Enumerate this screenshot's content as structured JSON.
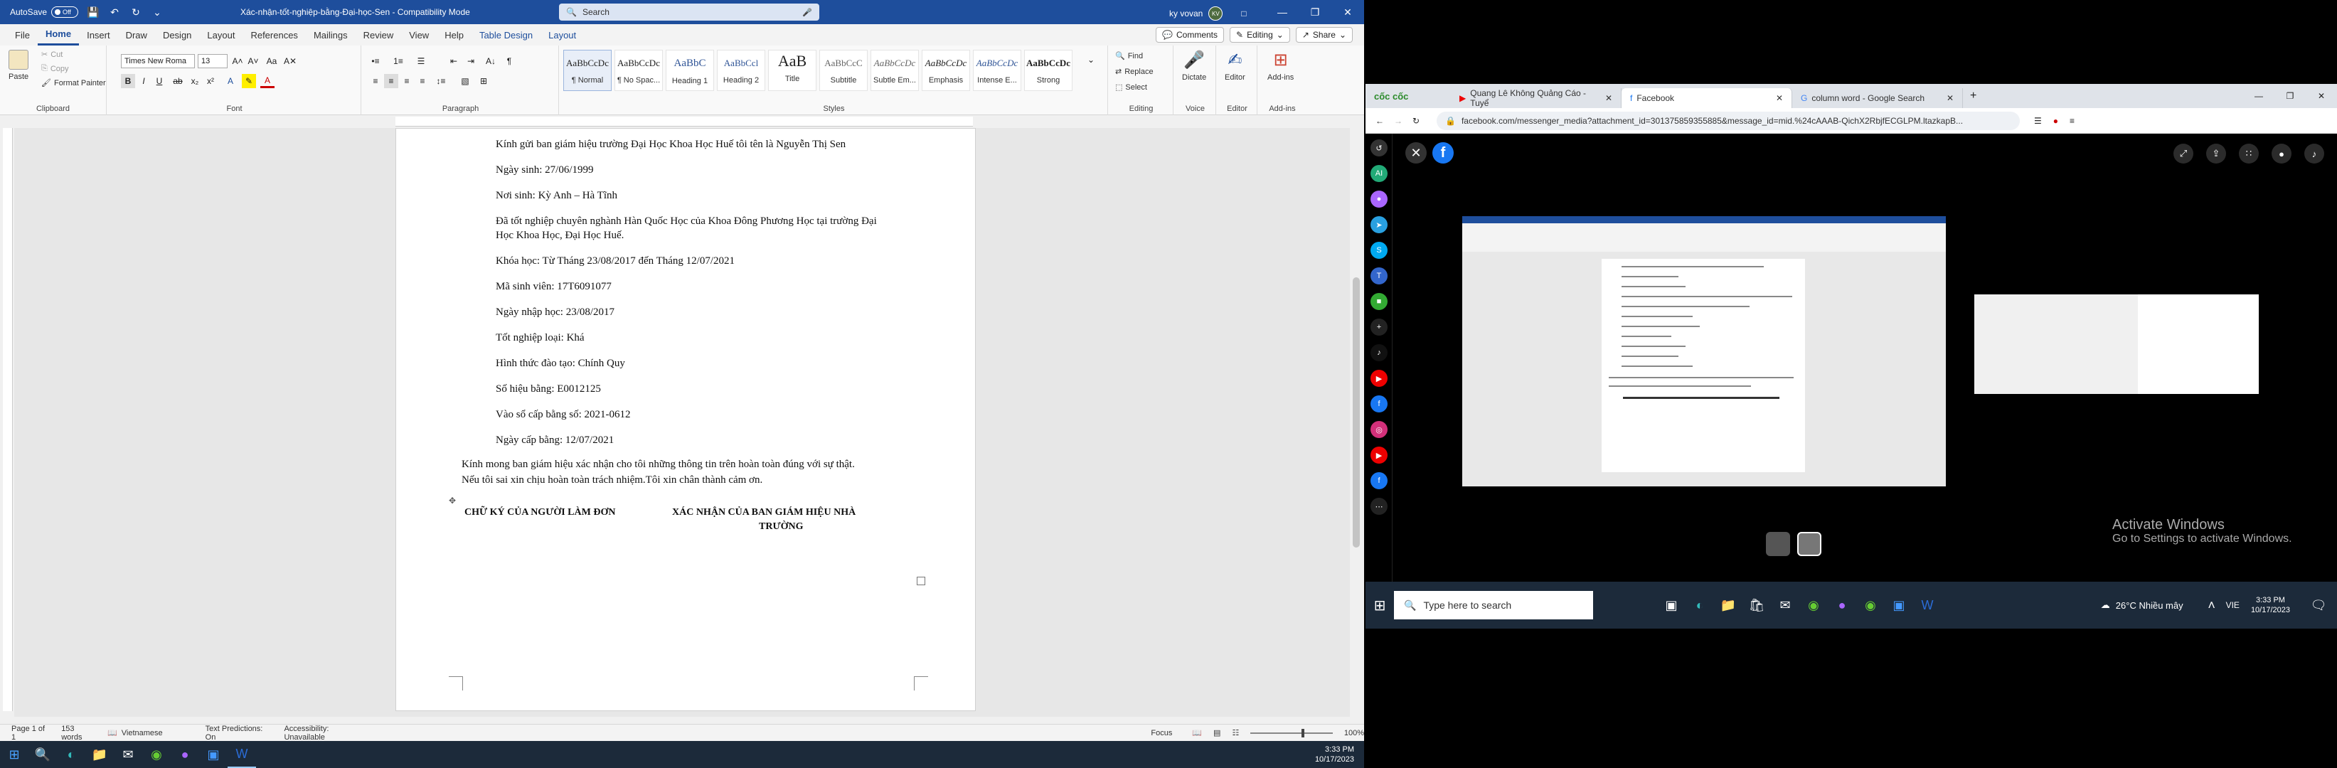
{
  "word": {
    "autosave_label": "AutoSave",
    "autosave_state": "Off",
    "doc_title": "Xác-nhận-tốt-nghiệp-bằng-Đại-học-Sen  -  Compatibility Mode",
    "search_placeholder": "Search",
    "user_name": "ky vovan",
    "user_initials": "KV",
    "tabs": [
      "File",
      "Home",
      "Insert",
      "Draw",
      "Design",
      "Layout",
      "References",
      "Mailings",
      "Review",
      "View",
      "Help",
      "Table Design",
      "Layout"
    ],
    "comments_label": "Comments",
    "editing_label": "Editing",
    "share_label": "Share",
    "ribbon": {
      "clipboard": {
        "paste": "Paste",
        "cut": "Cut",
        "copy": "Copy",
        "format_painter": "Format Painter",
        "label": "Clipboard"
      },
      "font": {
        "name": "Times New Roma",
        "size": "13",
        "label": "Font"
      },
      "paragraph_label": "Paragraph",
      "styles": [
        {
          "preview": "AaBbCcDc",
          "name": "¶ Normal"
        },
        {
          "preview": "AaBbCcDc",
          "name": "¶ No Spac..."
        },
        {
          "preview": "AaBbC",
          "name": "Heading 1"
        },
        {
          "preview": "AaBbCcl",
          "name": "Heading 2"
        },
        {
          "preview": "AaB",
          "name": "Title"
        },
        {
          "preview": "AaBbCcC",
          "name": "Subtitle"
        },
        {
          "preview": "AaBbCcDc",
          "name": "Subtle Em..."
        },
        {
          "preview": "AaBbCcDc",
          "name": "Emphasis"
        },
        {
          "preview": "AaBbCcDc",
          "name": "Intense E..."
        },
        {
          "preview": "AaBbCcDc",
          "name": "Strong"
        }
      ],
      "styles_label": "Styles",
      "editing": {
        "find": "Find",
        "replace": "Replace",
        "select": "Select",
        "label": "Editing"
      },
      "voice": {
        "dictate": "Dictate",
        "label": "Voice"
      },
      "editor": {
        "editor": "Editor",
        "label": "Editor"
      },
      "addins": {
        "addins": "Add-ins",
        "label": "Add-ins"
      }
    },
    "document": {
      "lines": [
        "Kính gửi ban giám hiệu trường Đại Học Khoa Học Huế tôi tên là Nguyễn Thị Sen",
        "Ngày sinh: 27/06/1999",
        "Nơi sinh: Kỳ Anh – Hà Tĩnh",
        "Đã tốt nghiệp chuyên nghành Hàn Quốc Học của Khoa Đông Phương Học tại trường Đại",
        "Học Khoa Học, Đại Học Huế.",
        "Khóa học: Từ Tháng 23/08/2017 đến Tháng 12/07/2021",
        "Mã sinh viên: 17T6091077",
        "Ngày nhập học: 23/08/2017",
        "Tốt nghiệp loại: Khá",
        "Hình thức đào tạo: Chính Quy",
        "Số hiệu bằng: E0012125",
        "Vào sổ cấp bằng số: 2021-0612",
        "Ngày cấp bằng: 12/07/2021"
      ],
      "closing_1": "Kính mong ban giám hiệu xác nhận cho tôi những thông tin trên hoàn toàn đúng với sự thật.",
      "closing_2": "Nếu tôi sai xin chịu hoàn toàn trách nhiệm.Tôi xin chân thành cảm ơn.",
      "sign_left": "CHỮ KÝ CỦA NGƯỜI LÀM ĐƠN",
      "sign_right_1": "XÁC NHẬN CỦA BAN GIÁM HIỆU NHÀ",
      "sign_right_2": "TRƯỜNG"
    },
    "status": {
      "page": "Page 1 of 1",
      "words": "153 words",
      "language": "Vietnamese",
      "predictions": "Text Predictions: On",
      "accessibility": "Accessibility: Unavailable",
      "focus": "Focus",
      "zoom": "100%"
    },
    "taskbar_time": "3:33 PM",
    "taskbar_date": "10/17/2023"
  },
  "browser": {
    "tabs": [
      {
        "title": "Quang Lê Không Quảng Cáo - Tuyể",
        "icon": "youtube-icon"
      },
      {
        "title": "Facebook",
        "icon": "facebook-icon"
      },
      {
        "title": "column word - Google Search",
        "icon": "google-icon"
      }
    ],
    "brand": "cốc cốc",
    "url": "facebook.com/messenger_media?attachment_id=301375859355885&message_id=mid.%24cAAAB-QichX2RbjfECGLPM.ltazkapB...",
    "activate_title": "Activate Windows",
    "activate_sub": "Go to Settings to activate Windows.",
    "taskbar": {
      "search_placeholder": "Type here to search",
      "weather": "26°C  Nhiều mây",
      "lang": "VIE",
      "time": "3:33 PM",
      "date": "10/17/2023"
    }
  },
  "colors": {
    "word_blue": "#1e4e9c",
    "fb_blue": "#1877f2",
    "taskbar": "#1c2a3a"
  }
}
